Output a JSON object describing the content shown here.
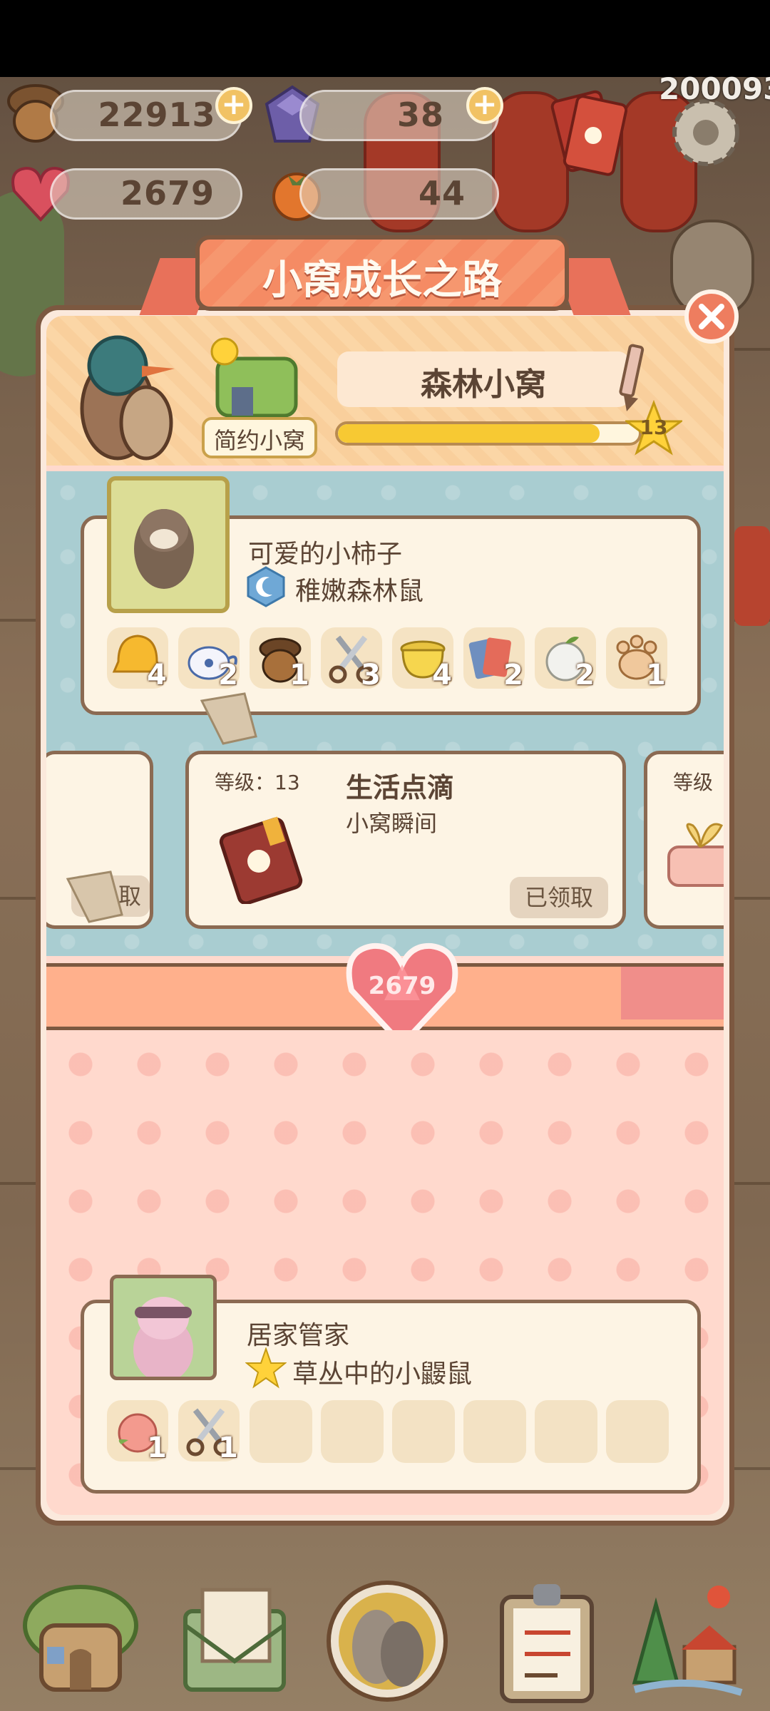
{
  "hud": {
    "acorns": "22913",
    "gems": "38",
    "hearts": "2679",
    "persimmons": "44",
    "id_number": "200093"
  },
  "panel": {
    "title": "小窝成长之路",
    "nest_name": "森林小窝",
    "nest_style": "简约小窝",
    "level_badge": "13",
    "progress_fraction": 0.87
  },
  "character_card": {
    "name": "可爱的小柿子",
    "rank": "稚嫩森林鼠",
    "items": [
      {
        "icon": "golden-bell-icon",
        "count": "4"
      },
      {
        "icon": "teapot-icon",
        "count": "2"
      },
      {
        "icon": "acorn-icon",
        "count": "1"
      },
      {
        "icon": "scissors-icon",
        "count": "3"
      },
      {
        "icon": "golden-pot-icon",
        "count": "4"
      },
      {
        "icon": "cards-icon",
        "count": "2"
      },
      {
        "icon": "white-fruit-icon",
        "count": "2"
      },
      {
        "icon": "paw-icon",
        "count": "1"
      }
    ]
  },
  "level_cards": [
    {
      "level_label": "等级：13",
      "title": "生活点滴",
      "subtitle": "小窝瞬间",
      "button": "已领取"
    },
    {
      "partial_button": "取"
    },
    {
      "partial_level": "等级"
    }
  ],
  "heart_total": "2679",
  "butler_card": {
    "role": "居家管家",
    "name": "草丛中的小鼹鼠",
    "items": [
      {
        "icon": "peach-icon",
        "count": "1"
      },
      {
        "icon": "scissors-icon",
        "count": "1"
      }
    ]
  },
  "colors": {
    "panel_border": "#7c5840",
    "title_ribbon": "#f58b64",
    "progress_fill": "#f7c933",
    "heart_band": "#ffb08c",
    "card_bg": "#fdf4e4"
  }
}
